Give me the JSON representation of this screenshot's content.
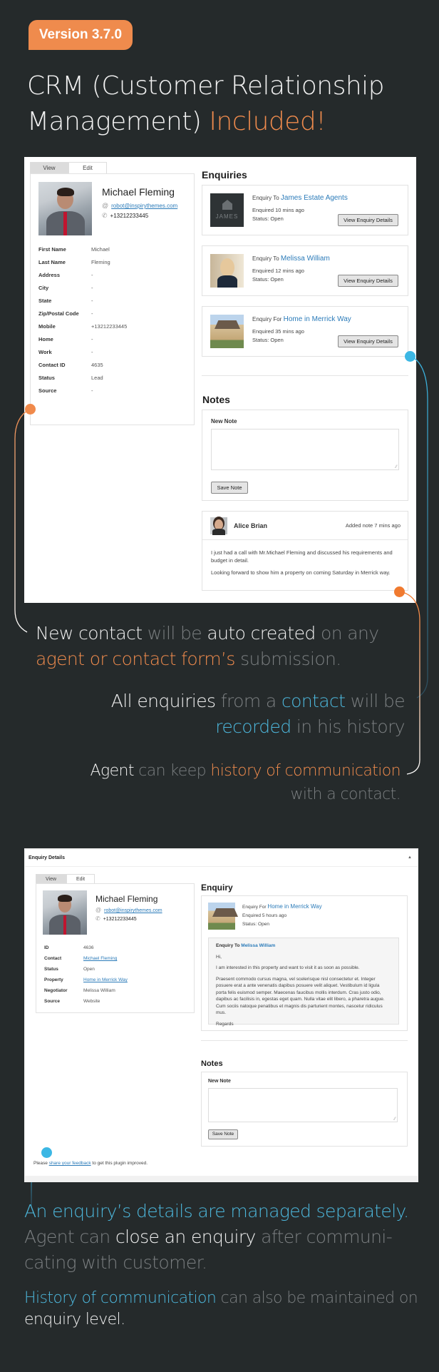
{
  "badge": {
    "label": "Version 3.7.0"
  },
  "headline": {
    "part1": "CRM (Customer Relationship Management) ",
    "accent": "Included!"
  },
  "colors": {
    "orange": "#ef8b4d",
    "blue": "#4db8dd",
    "background": "#252a2b",
    "link": "#2b7bb9"
  },
  "panel1": {
    "tabs": [
      {
        "label": "View",
        "active": true
      },
      {
        "label": "Edit",
        "active": false
      }
    ],
    "contact": {
      "name": "Michael Fleming",
      "email": "robot@inspirythemes.com",
      "phone": "+13212233445",
      "email_icon": "at-icon",
      "phone_icon": "phone-icon"
    },
    "fields": [
      {
        "label": "First Name",
        "value": "Michael"
      },
      {
        "label": "Last Name",
        "value": "Fleming"
      },
      {
        "label": "Address",
        "value": "-"
      },
      {
        "label": "City",
        "value": "-"
      },
      {
        "label": "State",
        "value": "-"
      },
      {
        "label": "Zip/Postal Code",
        "value": "-"
      },
      {
        "label": "Mobile",
        "value": "+13212233445"
      },
      {
        "label": "Home",
        "value": "-"
      },
      {
        "label": "Work",
        "value": "-"
      },
      {
        "label": "Contact ID",
        "value": "4635"
      },
      {
        "label": "Status",
        "value": "Lead"
      },
      {
        "label": "Source",
        "value": "-"
      }
    ],
    "enquiries_title": "Enquiries",
    "enquiries": [
      {
        "prefix": "Enquiry To",
        "target": "James Estate Agents",
        "time": "Enquired 10 mins ago",
        "status": "Status: Open",
        "button": "View Enquiry Details"
      },
      {
        "prefix": "Enquiry To",
        "target": "Melissa William",
        "time": "Enquired 12 mins ago",
        "status": "Status: Open",
        "button": "View Enquiry Details"
      },
      {
        "prefix": "Enquiry For",
        "target": "Home in Merrick Way",
        "time": "Enquired 35 mins ago",
        "status": "Status: Open",
        "button": "View Enquiry Details"
      }
    ],
    "notes_title": "Notes",
    "new_note_label": "New Note",
    "new_note_value": "",
    "save_note_button": "Save Note",
    "note": {
      "author": "Alice Brian",
      "time": "Added note 7 mins ago",
      "paragraphs": [
        "I just had a call with Mr.Michael Fleming and discussed his requirements and budget in detail.",
        "Looking forward to show him a property on coming Saturday in Merrick way."
      ]
    }
  },
  "callouts1": {
    "c1": [
      [
        "w",
        "New contact"
      ],
      [
        "g",
        " will be "
      ],
      [
        "w",
        "auto created"
      ],
      [
        "g",
        " on any "
      ],
      [
        "o",
        "agent or contact form’s"
      ],
      [
        "g",
        " submission."
      ]
    ],
    "c2": [
      [
        "w",
        "All enquiries"
      ],
      [
        "g",
        " from a "
      ],
      [
        "b",
        "contact"
      ],
      [
        "g",
        " will be "
      ],
      [
        "b",
        "recorded"
      ],
      [
        "g",
        " in his history"
      ]
    ],
    "c3": [
      [
        "w",
        "Agent"
      ],
      [
        "g",
        " can keep "
      ],
      [
        "o",
        "history of communication"
      ],
      [
        "g",
        " with a contact."
      ]
    ]
  },
  "panel2": {
    "header_title": "Enquiry Details",
    "collapse_icon": "caret-up-icon",
    "tabs": [
      {
        "label": "View",
        "active": true
      },
      {
        "label": "Edit",
        "active": false
      }
    ],
    "contact": {
      "name": "Michael Fleming",
      "email": "robot@inspirythemes.com",
      "phone": "+13212233445"
    },
    "fields": [
      {
        "label": "ID",
        "value": "4636",
        "link": false
      },
      {
        "label": "Contact",
        "value": "Michael Fleming",
        "link": true
      },
      {
        "label": "Status",
        "value": "Open",
        "link": false
      },
      {
        "label": "Property",
        "value": "Home in Merrick Way",
        "link": true
      },
      {
        "label": "Negotiator",
        "value": "Melissa William",
        "link": false
      },
      {
        "label": "Source",
        "value": "Website",
        "link": false
      }
    ],
    "enquiry_title": "Enquiry",
    "enquiry": {
      "prefix": "Enquiry For",
      "target": "Home in Merrick Way",
      "time": "Enquired 5 hours ago",
      "status": "Status: Open"
    },
    "message": {
      "to_prefix": "Enquiry To",
      "to_name": "Melissa William",
      "paragraphs": [
        "Hi,",
        "I am interested in this property and want to visit it as soon as possible.",
        "Praesent commodo cursus magna, vel scelerisque nisl consectetur et. Integer posuere erat a ante venenatis dapibus posuere velit aliquet. Vestibulum id ligula porta felis euismod semper. Maecenas faucibus mollis interdum. Cras justo odio, dapibus ac facilisis in, egestas eget quam. Nulla vitae elit libero, a pharetra augue. Cum sociis natoque penatibus et magnis dis parturient montes, nascetur ridiculus mus.",
        "Regards"
      ]
    },
    "notes_title": "Notes",
    "new_note_label": "New Note",
    "new_note_value": "",
    "save_note_button": "Save Note",
    "footer": {
      "before": "Please ",
      "link": "share your feedback",
      "after": " to get this plugin improved."
    }
  },
  "callouts2": {
    "c1": [
      [
        "b",
        "An enquiry’s details are managed separately."
      ],
      [
        "g",
        " Agent can "
      ],
      [
        "w",
        "close an enquiry"
      ],
      [
        "g",
        " after communi-cating with customer."
      ]
    ],
    "c2": [
      [
        "b",
        "History of communication"
      ],
      [
        "g",
        " can also be maintained on "
      ],
      [
        "w",
        "enquiry level."
      ]
    ]
  }
}
